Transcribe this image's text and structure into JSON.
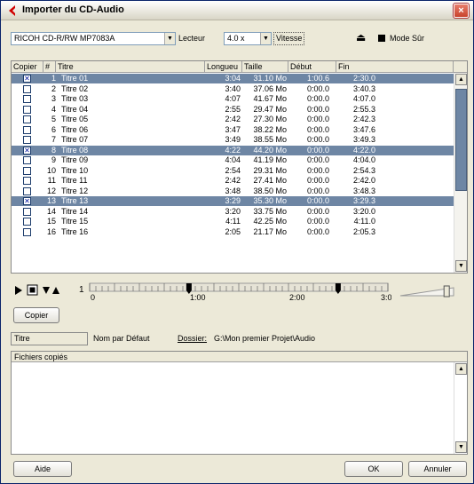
{
  "window": {
    "title": "Importer du CD-Audio",
    "close_label": "×"
  },
  "toolbar": {
    "drive": "RICOH   CD-R/RW MP7083A",
    "drive_label": "Lecteur",
    "speed": "4.0 x",
    "speed_label": "Vitesse",
    "safe_mode_label": "Mode Sûr",
    "eject_glyph": "⏏"
  },
  "table": {
    "headers": [
      "Copier",
      "#",
      "Titre",
      "Longueu",
      "Taille",
      "Début",
      "Fin"
    ],
    "rows": [
      {
        "checked": true,
        "num": "1",
        "title": "Titre 01",
        "length": "3:04",
        "size": "31.10 Mo",
        "start": "1:00.6",
        "end": "2:30.0"
      },
      {
        "checked": false,
        "num": "2",
        "title": "Titre 02",
        "length": "3:40",
        "size": "37.06 Mo",
        "start": "0:00.0",
        "end": "3:40.3"
      },
      {
        "checked": false,
        "num": "3",
        "title": "Titre 03",
        "length": "4:07",
        "size": "41.67 Mo",
        "start": "0:00.0",
        "end": "4:07.0"
      },
      {
        "checked": false,
        "num": "4",
        "title": "Titre 04",
        "length": "2:55",
        "size": "29.47 Mo",
        "start": "0:00.0",
        "end": "2:55.3"
      },
      {
        "checked": false,
        "num": "5",
        "title": "Titre 05",
        "length": "2:42",
        "size": "27.30 Mo",
        "start": "0:00.0",
        "end": "2:42.3"
      },
      {
        "checked": false,
        "num": "6",
        "title": "Titre 06",
        "length": "3:47",
        "size": "38.22 Mo",
        "start": "0:00.0",
        "end": "3:47.6"
      },
      {
        "checked": false,
        "num": "7",
        "title": "Titre 07",
        "length": "3:49",
        "size": "38.55 Mo",
        "start": "0:00.0",
        "end": "3:49.3"
      },
      {
        "checked": true,
        "num": "8",
        "title": "Titre 08",
        "length": "4:22",
        "size": "44.20 Mo",
        "start": "0:00.0",
        "end": "4:22.0"
      },
      {
        "checked": false,
        "num": "9",
        "title": "Titre 09",
        "length": "4:04",
        "size": "41.19 Mo",
        "start": "0:00.0",
        "end": "4:04.0"
      },
      {
        "checked": false,
        "num": "10",
        "title": "Titre 10",
        "length": "2:54",
        "size": "29.31 Mo",
        "start": "0:00.0",
        "end": "2:54.3"
      },
      {
        "checked": false,
        "num": "11",
        "title": "Titre 11",
        "length": "2:42",
        "size": "27.41 Mo",
        "start": "0:00.0",
        "end": "2:42.0"
      },
      {
        "checked": false,
        "num": "12",
        "title": "Titre 12",
        "length": "3:48",
        "size": "38.50 Mo",
        "start": "0:00.0",
        "end": "3:48.3"
      },
      {
        "checked": true,
        "num": "13",
        "title": "Titre 13",
        "length": "3:29",
        "size": "35.30 Mo",
        "start": "0:00.0",
        "end": "3:29.3"
      },
      {
        "checked": false,
        "num": "14",
        "title": "Titre 14",
        "length": "3:20",
        "size": "33.75 Mo",
        "start": "0:00.0",
        "end": "3:20.0"
      },
      {
        "checked": false,
        "num": "15",
        "title": "Titre 15",
        "length": "4:11",
        "size": "42.25 Mo",
        "start": "0:00.0",
        "end": "4:11.0"
      },
      {
        "checked": false,
        "num": "16",
        "title": "Titre 16",
        "length": "2:05",
        "size": "21.17 Mo",
        "start": "0:00.0",
        "end": "2:05.3"
      }
    ]
  },
  "transport": {
    "ruler_start": "1",
    "ticks": [
      "0",
      "1:00",
      "2:00",
      "3:0"
    ],
    "range_start_fraction": 0.333,
    "range_end_fraction": 0.833,
    "volume_fraction": 0.87
  },
  "copy_button": "Copier",
  "naming": {
    "name_value": "Titre",
    "name_caption": "Nom par Défaut",
    "folder_label": "Dossier:",
    "folder_path": "G:\\Mon premier Projet\\Audio"
  },
  "files_panel": {
    "header": "Fichiers copiés"
  },
  "footer": {
    "help": "Aide",
    "ok": "OK",
    "cancel": "Annuler"
  },
  "colors": {
    "selection": "#6e86a4",
    "check": "#00139c",
    "brand": "#d00000"
  }
}
